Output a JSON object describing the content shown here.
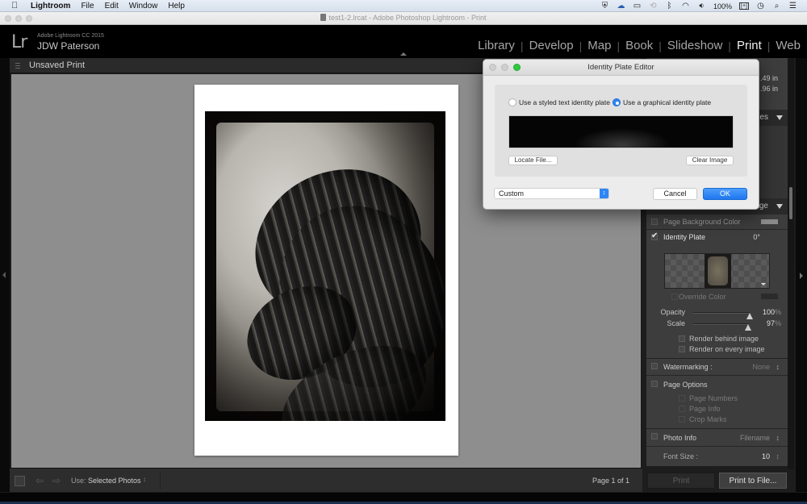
{
  "menubar": {
    "apple": "",
    "app_name": "Lightroom",
    "items": [
      "File",
      "Edit",
      "Window",
      "Help"
    ],
    "status": {
      "icons": [
        "shield-icon",
        "cloud-icon",
        "airplay-icon",
        "time-machine-icon",
        "bluetooth-icon",
        "wifi-icon",
        "volume-icon"
      ],
      "battery_text": "100%",
      "battery_badge": "[+]",
      "trailing_icons": [
        "clock-icon",
        "search-icon",
        "list-icon"
      ]
    }
  },
  "window": {
    "title": "test1-2.lrcat - Adobe Photoshop Lightroom - Print"
  },
  "lr_header": {
    "logo": "Lr",
    "product": "Adobe Lightroom CC 2015",
    "identity_plate": "JDW Paterson",
    "modules": [
      {
        "label": "Library",
        "active": false
      },
      {
        "label": "Develop",
        "active": false
      },
      {
        "label": "Map",
        "active": false
      },
      {
        "label": "Book",
        "active": false
      },
      {
        "label": "Slideshow",
        "active": false
      },
      {
        "label": "Print",
        "active": true
      },
      {
        "label": "Web",
        "active": false
      }
    ],
    "separator": "|"
  },
  "center": {
    "title": "Unsaved Print"
  },
  "toolbar": {
    "use_label": "Use:",
    "use_value": "Selected Photos",
    "use_arrows": "↕",
    "page_count": "Page 1 of 1",
    "prev": "⇦",
    "next": "⇨"
  },
  "right_panel": {
    "partial_values": [
      ".49 in",
      ".96 in"
    ],
    "section_guides_partial": "des",
    "section_page_partial": "age",
    "page_background_color": {
      "label": "Page Background Color",
      "checked": false
    },
    "identity_plate": {
      "label": "Identity Plate",
      "checked": true,
      "angle": "0°"
    },
    "override_color": {
      "label": "Override Color",
      "checked": false
    },
    "opacity": {
      "label": "Opacity",
      "value": 100,
      "unit": "%",
      "value_text": "100"
    },
    "scale": {
      "label": "Scale",
      "value": 97,
      "unit": "%",
      "value_text": "97"
    },
    "render_behind_image": {
      "label": "Render behind image",
      "checked": false
    },
    "render_on_every_image": {
      "label": "Render on every image",
      "checked": false
    },
    "watermarking": {
      "label": "Watermarking :",
      "value": "None",
      "arrows": "↕"
    },
    "page_options": {
      "label": "Page Options",
      "checked": false
    },
    "page_numbers": {
      "label": "Page Numbers"
    },
    "page_info": {
      "label": "Page Info"
    },
    "crop_marks": {
      "label": "Crop Marks"
    },
    "photo_info": {
      "label": "Photo Info",
      "value": "Filename",
      "arrows": "↕"
    },
    "font_size": {
      "label": "Font Size :",
      "value": "10",
      "arrows": "↕"
    },
    "print_button": "Print",
    "print_to_file_button": "Print to File..."
  },
  "dialog": {
    "title": "Identity Plate Editor",
    "radio_text": {
      "label": "Use a styled text identity plate",
      "selected": false
    },
    "radio_graphical": {
      "label": "Use a graphical identity plate",
      "selected": true
    },
    "locate_file": "Locate File...",
    "clear_image": "Clear Image",
    "preset_value": "Custom",
    "preset_arrows": "↕",
    "cancel": "Cancel",
    "ok": "OK",
    "accent_color": "#2f86f5"
  }
}
